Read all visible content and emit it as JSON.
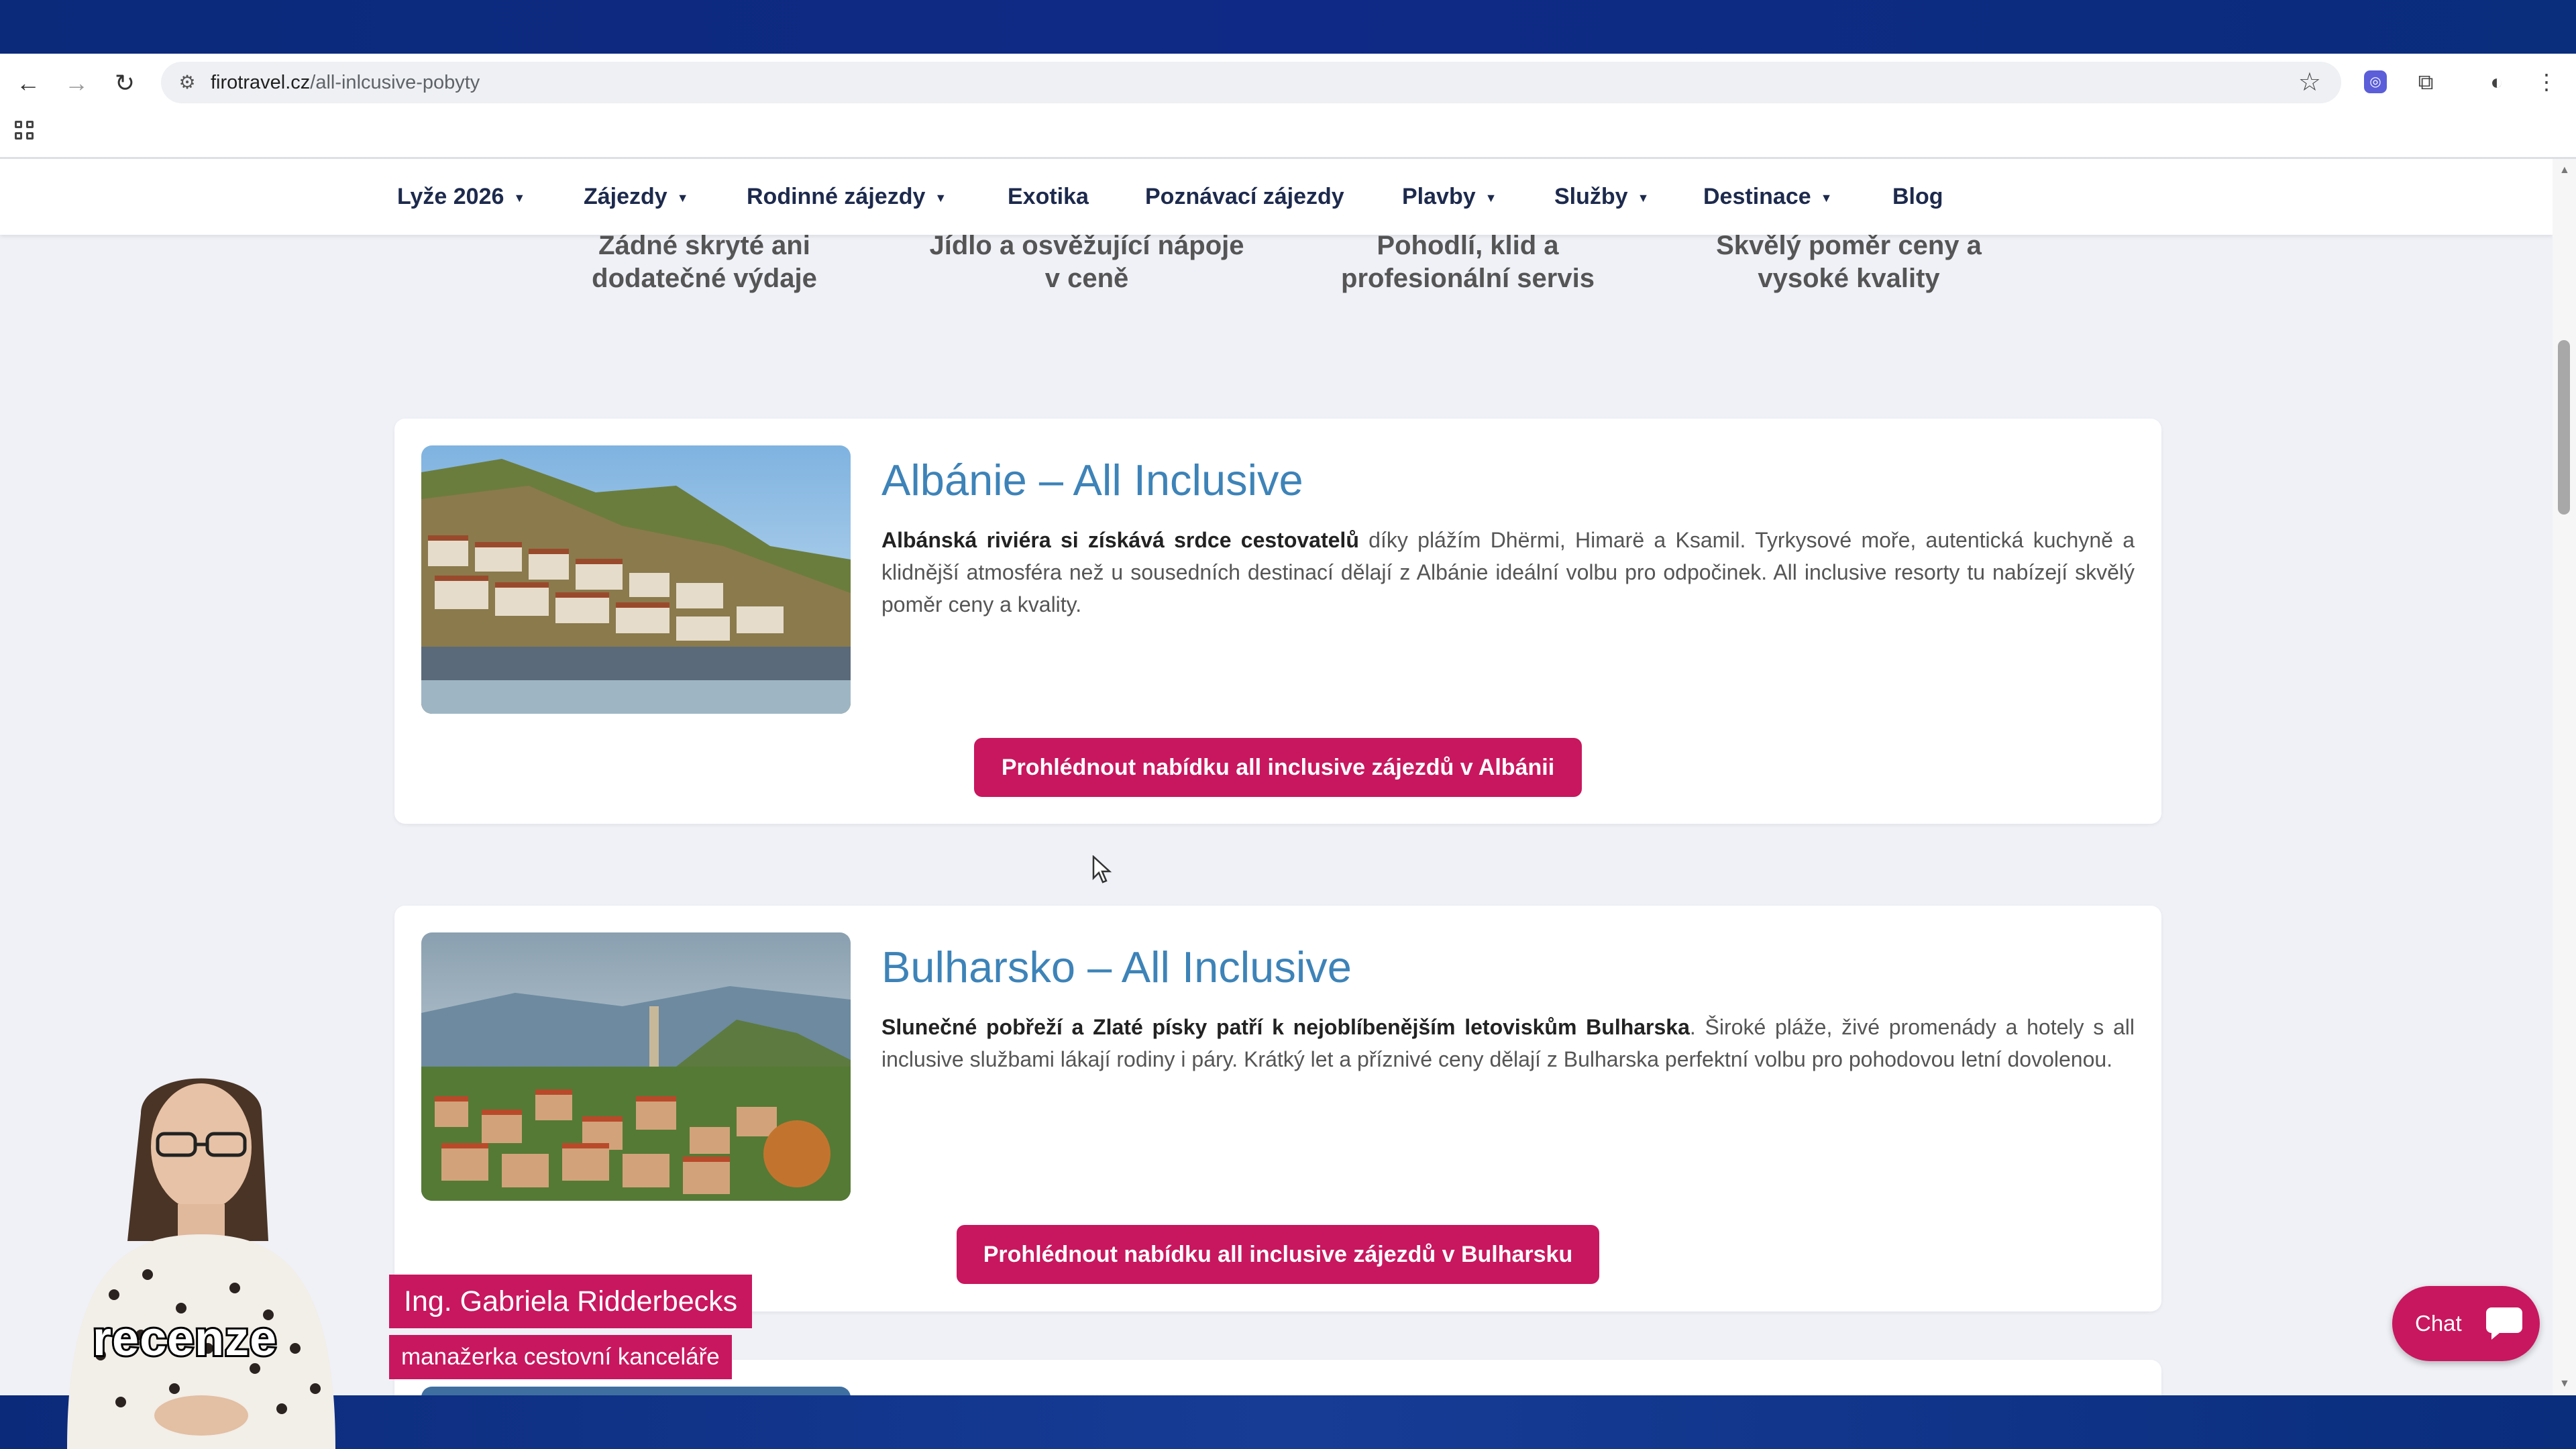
{
  "browser": {
    "url_host": "firotravel.cz",
    "url_path": "/all-inlcusive-pobyty"
  },
  "site_nav": {
    "items": [
      {
        "label": "Lyže 2026",
        "dropdown": true
      },
      {
        "label": "Zájezdy",
        "dropdown": true
      },
      {
        "label": "Rodinné zájezdy",
        "dropdown": true
      },
      {
        "label": "Exotika",
        "dropdown": false
      },
      {
        "label": "Poznávací zájezdy",
        "dropdown": false
      },
      {
        "label": "Plavby",
        "dropdown": true
      },
      {
        "label": "Služby",
        "dropdown": true
      },
      {
        "label": "Destinace",
        "dropdown": true
      },
      {
        "label": "Blog",
        "dropdown": false
      }
    ]
  },
  "features": [
    {
      "line1": "Žádné skryté ani",
      "line2": "dodatečné výdaje"
    },
    {
      "line1": "Jídlo a osvěžující nápoje",
      "line2": "v ceně"
    },
    {
      "line1": "Pohodlí, klid a",
      "line2": "profesionální servis"
    },
    {
      "line1": "Skvělý poměr ceny a",
      "line2": "vysoké kvality"
    }
  ],
  "cards": [
    {
      "title": "Albánie – All Inclusive",
      "text_bold": "Albánská riviéra si získává srdce cestovatelů",
      "text_rest": " díky plážím Dhërmi, Himarë a Ksamil. Tyrkysové moře, autentická kuchyně a klidnější atmosféra než u sousedních destinací dělají z Albánie ideální volbu pro odpočinek. All inclusive resorty tu nabízejí skvělý poměr ceny a kvality.",
      "button": "Prohlédnout nabídku all inclusive zájezdů v Albánii"
    },
    {
      "title": "Bulharsko – All Inclusive",
      "text_bold": "Slunečné pobřeží a Zlaté písky patří k nejoblíbenějším letoviskům Bulharska",
      "text_rest": ". Široké pláže, živé promenády a hotely s all inclusive službami lákají rodiny i páry. Krátký let a příznivé ceny dělají z Bulharska perfektní volbu pro pohodovou letní dovolenou.",
      "button": "Prohlédnout nabídku all inclusive zájezdů v Bulharsku"
    }
  ],
  "overlay": {
    "presenter_name": "Ing. Gabriela Ridderbecks",
    "presenter_role": "manažerka cestovní kanceláře",
    "caption": "recenze"
  },
  "chat": {
    "label": "Chat"
  },
  "colors": {
    "accent": "#c8175e",
    "title_blue": "#3d83b8",
    "nav_text": "#1d2a4d",
    "frame_blue": "#0d2a78"
  }
}
